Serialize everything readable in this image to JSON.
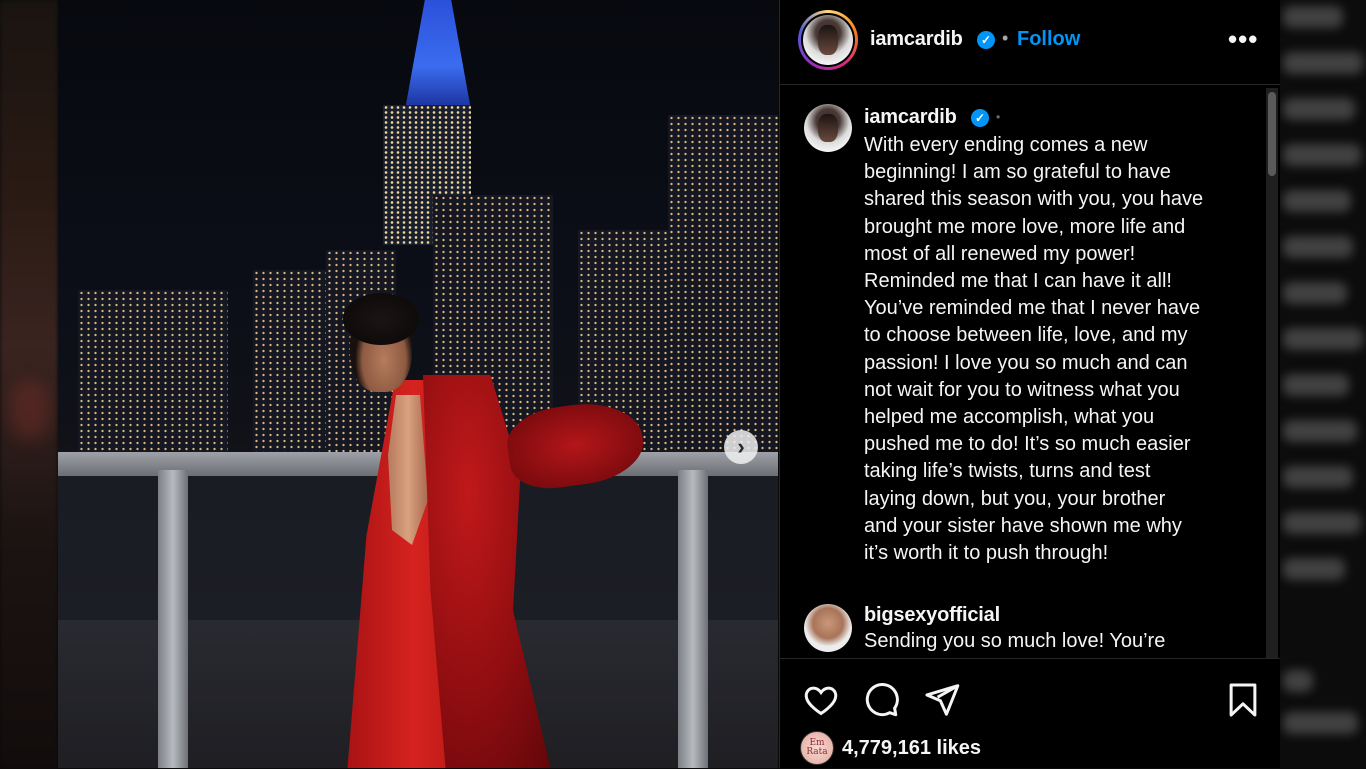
{
  "post": {
    "author": "iamcardib",
    "follow_label": "Follow",
    "more_label": "•••",
    "next_label": "›"
  },
  "caption": {
    "username": "iamcardib",
    "lines": [
      "With every ending comes a new",
      "beginning! I am so grateful to have",
      "shared this season with you, you have",
      "brought me more love, more life and",
      "most of all renewed my power!",
      "Reminded me that I can have it all!",
      "You’ve reminded me that I never have",
      "to choose between life, love, and my",
      "passion! I love you so much and can",
      "not wait for you to witness what you",
      "helped me accomplish, what you",
      "pushed me to do! It’s so much easier",
      "taking life’s twists, turns and test",
      "laying down, but you, your brother",
      "and your sister have shown me why",
      "it’s worth it to push through!"
    ]
  },
  "reply": {
    "username": "bigsexyofficial",
    "text": "Sending you so much love! You’re"
  },
  "likes": {
    "count": "4,779,161 likes",
    "liker_avatar_text": "Em Rata"
  },
  "icons": {
    "verified": "verified-badge-icon",
    "like": "heart-icon",
    "comment": "comment-bubble-icon",
    "share": "paper-plane-icon",
    "save": "bookmark-icon",
    "next": "chevron-right-icon",
    "more": "more-options-icon"
  },
  "colors": {
    "accent": "#0095f6",
    "panel_bg": "#000000",
    "text": "#f5f5f5"
  }
}
